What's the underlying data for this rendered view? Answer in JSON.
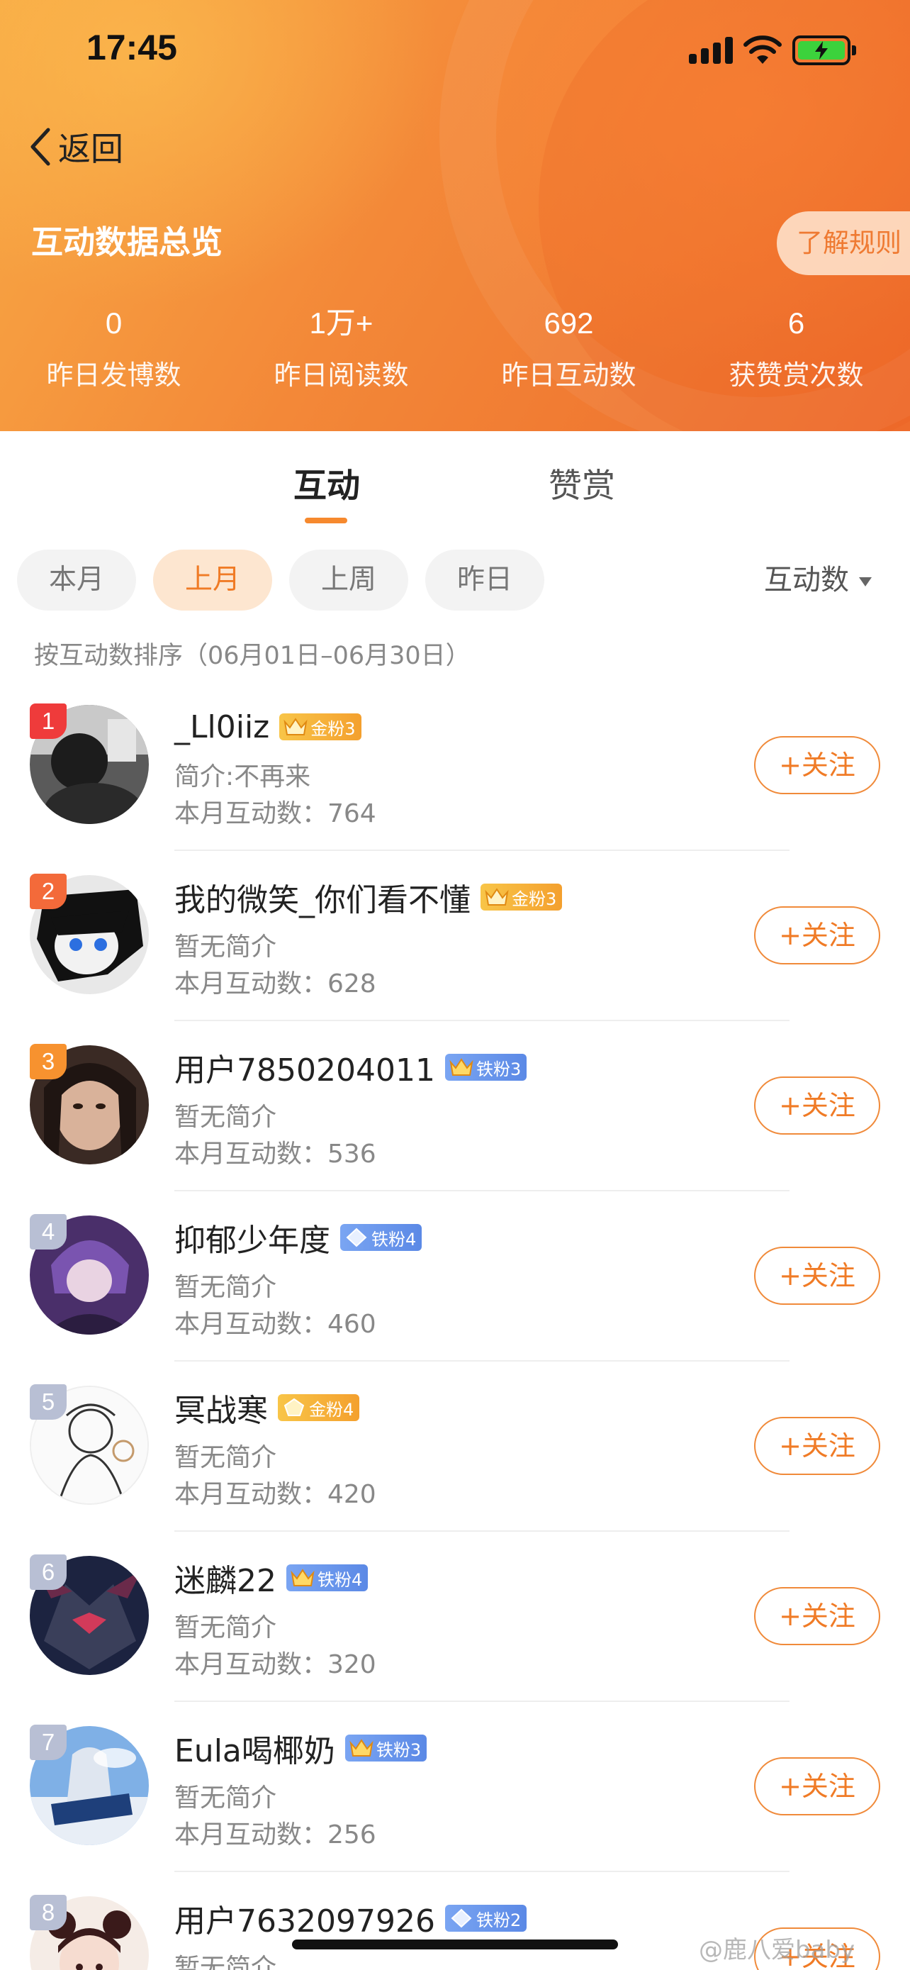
{
  "status_bar": {
    "time": "17:45"
  },
  "nav": {
    "back_label": "返回"
  },
  "header": {
    "title": "互动数据总览",
    "rules_button": "了解规则",
    "stats": [
      {
        "value": "0",
        "label": "昨日发博数"
      },
      {
        "value": "1万+",
        "label": "昨日阅读数"
      },
      {
        "value": "692",
        "label": "昨日互动数"
      },
      {
        "value": "6",
        "label": "获赞赏次数"
      }
    ]
  },
  "tabs": [
    {
      "label": "互动",
      "active": true
    },
    {
      "label": "赞赏",
      "active": false
    }
  ],
  "filters": {
    "chips": [
      {
        "label": "本月",
        "active": false
      },
      {
        "label": "上月",
        "active": true
      },
      {
        "label": "上周",
        "active": false
      },
      {
        "label": "昨日",
        "active": false
      }
    ],
    "sort_label": "互动数"
  },
  "sort_description": "按互动数排序（06月01日–06月30日）",
  "follow_label": "+关注",
  "users": [
    {
      "rank": "1",
      "name": "_Ll0iiz",
      "badge_type": "gold",
      "badge": "金粉3",
      "intro": "简介:不再来",
      "count_text": "本月互动数：764"
    },
    {
      "rank": "2",
      "name": "我的微笑_你们看不懂",
      "badge_type": "gold",
      "badge": "金粉3",
      "intro": "暂无简介",
      "count_text": "本月互动数：628"
    },
    {
      "rank": "3",
      "name": "用户7850204011",
      "badge_type": "iron",
      "badge": "铁粉3",
      "intro": "暂无简介",
      "count_text": "本月互动数：536"
    },
    {
      "rank": "4",
      "name": "抑郁少年度",
      "badge_type": "iron",
      "badge": "铁粉4",
      "intro": "暂无简介",
      "count_text": "本月互动数：460"
    },
    {
      "rank": "5",
      "name": "冥战寒",
      "badge_type": "gold",
      "badge": "金粉4",
      "intro": "暂无简介",
      "count_text": "本月互动数：420"
    },
    {
      "rank": "6",
      "name": "迷麟22",
      "badge_type": "iron",
      "badge": "铁粉4",
      "intro": "暂无简介",
      "count_text": "本月互动数：320"
    },
    {
      "rank": "7",
      "name": "Eula喝椰奶",
      "badge_type": "iron",
      "badge": "铁粉3",
      "intro": "暂无简介",
      "count_text": "本月互动数：256"
    },
    {
      "rank": "8",
      "name": "用户7632097926",
      "badge_type": "iron",
      "badge": "铁粉2",
      "intro": "暂无简介",
      "count_text": ""
    }
  ],
  "watermark": "@鹿八爱baby",
  "colors": {
    "accent": "#f07b26",
    "gold_badge": "#f4a02e",
    "iron_badge": "#5b89e6",
    "rank1": "#ef3b3b",
    "rank2": "#f36a3a",
    "rank3": "#f7922f",
    "rank_other": "#b8bfd4"
  },
  "icons": [
    "back-chevron-icon",
    "signal-icon",
    "wifi-icon",
    "battery-icon",
    "crown-icon",
    "diamond-icon",
    "dropdown-arrow-icon"
  ]
}
